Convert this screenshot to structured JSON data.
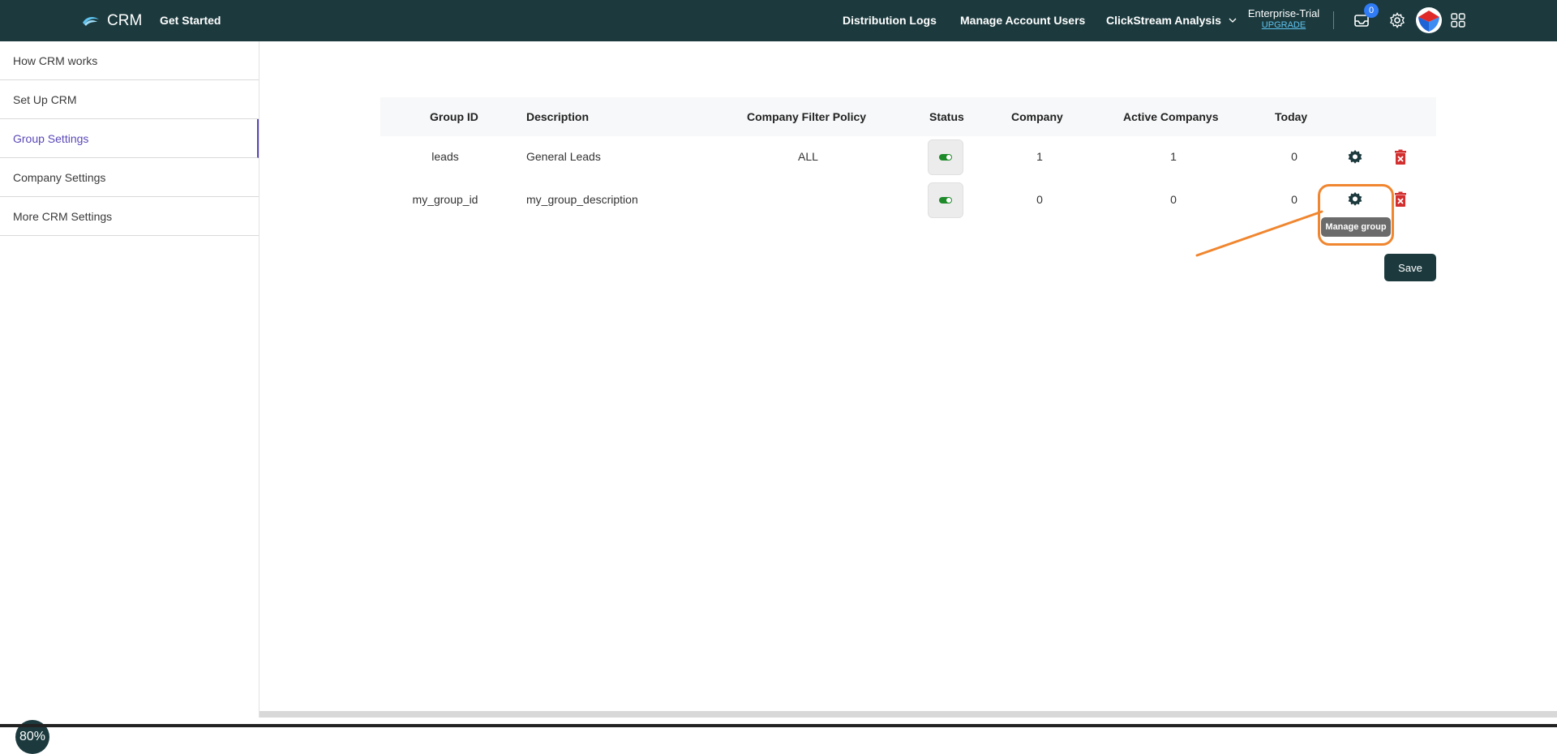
{
  "header": {
    "brand": "CRM",
    "get_started": "Get Started",
    "nav": [
      "Distribution Logs",
      "Manage Account Users",
      "ClickStream Analysis"
    ],
    "plan_name": "Enterprise-Trial",
    "upgrade": "UPGRADE",
    "inbox_count": "0",
    "colors": {
      "bar": "#1c3a3e",
      "badge": "#2f7cf6"
    }
  },
  "sidebar": {
    "items": [
      {
        "label": "How CRM works"
      },
      {
        "label": "Set Up CRM"
      },
      {
        "label": "Group Settings"
      },
      {
        "label": "Company Settings"
      },
      {
        "label": "More CRM Settings"
      }
    ],
    "active_index": 2,
    "zoom": "80%"
  },
  "table": {
    "headers": [
      "Group ID",
      "Description",
      "Company Filter Policy",
      "Status",
      "Company",
      "Active Companys",
      "Today"
    ],
    "rows": [
      {
        "group_id": "leads",
        "description": "General Leads",
        "policy": "ALL",
        "status": "on",
        "company": "1",
        "active": "1",
        "today": "0"
      },
      {
        "group_id": "my_group_id",
        "description": "my_group_description",
        "policy": "",
        "status": "on",
        "company": "0",
        "active": "0",
        "today": "0"
      }
    ],
    "row_icons": [
      "gear-icon",
      "delete-icon"
    ]
  },
  "tooltip": "Manage group",
  "save_label": "Save",
  "annotation_color": "#f0862f"
}
